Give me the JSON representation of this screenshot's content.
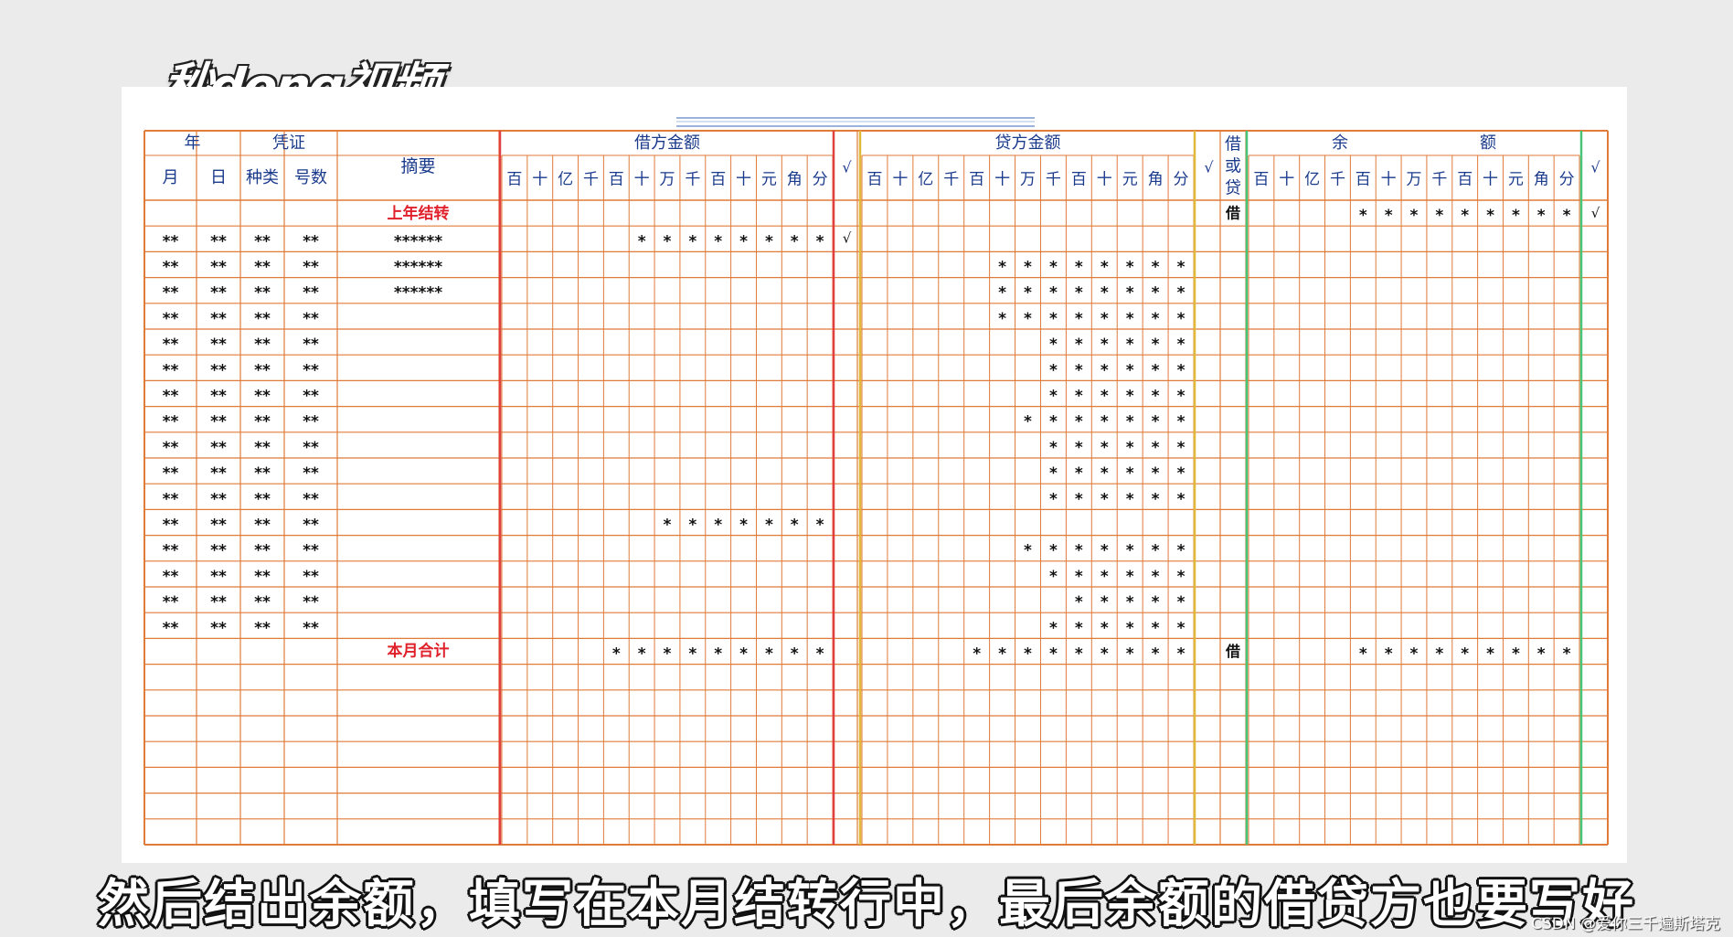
{
  "brand": {
    "logo_text": "秒dong视频"
  },
  "ledger": {
    "colors": {
      "orange": "#e07b39",
      "red": "#e0403f",
      "yellow": "#e0b93a",
      "green": "#49c57a",
      "header_text": "#1a3a8c",
      "red_text": "#e0202a",
      "body_text": "#111111"
    },
    "header": {
      "year": "年",
      "voucher": "凭证",
      "month": "月",
      "day": "日",
      "voucher_type": "种类",
      "voucher_no": "号数",
      "summary": "摘要",
      "debit_amount": "借方金额",
      "credit_amount": "贷方金额",
      "debit_or_credit": "借或贷",
      "balance_left": "余",
      "balance_right": "额",
      "check": "√",
      "digit_units": [
        "百",
        "十",
        "亿",
        "千",
        "百",
        "十",
        "万",
        "千",
        "百",
        "十",
        "元",
        "角",
        "分"
      ]
    },
    "opening_row": {
      "summary": "上年结转",
      "direction": "借",
      "balance_digits": [
        "",
        "",
        "",
        "",
        "*",
        "*",
        "*",
        "*",
        "*",
        "*",
        "*",
        "*",
        "*"
      ],
      "balance_check": "√"
    },
    "rows": [
      {
        "date": [
          "**",
          "**",
          "**",
          "**"
        ],
        "summary": "******",
        "debit": [
          "",
          "",
          "",
          "",
          "",
          "*",
          "*",
          "*",
          "*",
          "*",
          "*",
          "*",
          "*"
        ],
        "debit_check": "√",
        "credit": [
          "",
          "",
          "",
          "",
          "",
          "",
          "",
          "",
          "",
          "",
          "",
          "",
          ""
        ]
      },
      {
        "date": [
          "**",
          "**",
          "**",
          "**"
        ],
        "summary": "******",
        "debit": [
          "",
          "",
          "",
          "",
          "",
          "",
          "",
          "",
          "",
          "",
          "",
          "",
          ""
        ],
        "credit": [
          "",
          "",
          "",
          "",
          "",
          "*",
          "*",
          "*",
          "*",
          "*",
          "*",
          "*",
          "*"
        ]
      },
      {
        "date": [
          "**",
          "**",
          "**",
          "**"
        ],
        "summary": "******",
        "debit": [
          "",
          "",
          "",
          "",
          "",
          "",
          "",
          "",
          "",
          "",
          "",
          "",
          ""
        ],
        "credit": [
          "",
          "",
          "",
          "",
          "",
          "*",
          "*",
          "*",
          "*",
          "*",
          "*",
          "*",
          "*"
        ]
      },
      {
        "date": [
          "**",
          "**",
          "**",
          "**"
        ],
        "summary": "",
        "debit": [
          "",
          "",
          "",
          "",
          "",
          "",
          "",
          "",
          "",
          "",
          "",
          "",
          ""
        ],
        "credit": [
          "",
          "",
          "",
          "",
          "",
          "*",
          "*",
          "*",
          "*",
          "*",
          "*",
          "*",
          "*"
        ]
      },
      {
        "date": [
          "**",
          "**",
          "**",
          "**"
        ],
        "summary": "",
        "debit": [
          "",
          "",
          "",
          "",
          "",
          "",
          "",
          "",
          "",
          "",
          "",
          "",
          ""
        ],
        "credit": [
          "",
          "",
          "",
          "",
          "",
          "",
          "",
          "*",
          "*",
          "*",
          "*",
          "*",
          "*"
        ]
      },
      {
        "date": [
          "**",
          "**",
          "**",
          "**"
        ],
        "summary": "",
        "debit": [
          "",
          "",
          "",
          "",
          "",
          "",
          "",
          "",
          "",
          "",
          "",
          "",
          ""
        ],
        "credit": [
          "",
          "",
          "",
          "",
          "",
          "",
          "",
          "*",
          "*",
          "*",
          "*",
          "*",
          "*"
        ]
      },
      {
        "date": [
          "**",
          "**",
          "**",
          "**"
        ],
        "summary": "",
        "debit": [
          "",
          "",
          "",
          "",
          "",
          "",
          "",
          "",
          "",
          "",
          "",
          "",
          ""
        ],
        "credit": [
          "",
          "",
          "",
          "",
          "",
          "",
          "",
          "*",
          "*",
          "*",
          "*",
          "*",
          "*"
        ]
      },
      {
        "date": [
          "**",
          "**",
          "**",
          "**"
        ],
        "summary": "",
        "debit": [
          "",
          "",
          "",
          "",
          "",
          "",
          "",
          "",
          "",
          "",
          "",
          "",
          ""
        ],
        "credit": [
          "",
          "",
          "",
          "",
          "",
          "",
          "*",
          "*",
          "*",
          "*",
          "*",
          "*",
          "*"
        ]
      },
      {
        "date": [
          "**",
          "**",
          "**",
          "**"
        ],
        "summary": "",
        "debit": [
          "",
          "",
          "",
          "",
          "",
          "",
          "",
          "",
          "",
          "",
          "",
          "",
          ""
        ],
        "credit": [
          "",
          "",
          "",
          "",
          "",
          "",
          "",
          "*",
          "*",
          "*",
          "*",
          "*",
          "*"
        ]
      },
      {
        "date": [
          "**",
          "**",
          "**",
          "**"
        ],
        "summary": "",
        "debit": [
          "",
          "",
          "",
          "",
          "",
          "",
          "",
          "",
          "",
          "",
          "",
          "",
          ""
        ],
        "credit": [
          "",
          "",
          "",
          "",
          "",
          "",
          "",
          "*",
          "*",
          "*",
          "*",
          "*",
          "*"
        ]
      },
      {
        "date": [
          "**",
          "**",
          "**",
          "**"
        ],
        "summary": "",
        "debit": [
          "",
          "",
          "",
          "",
          "",
          "",
          "",
          "",
          "",
          "",
          "",
          "",
          ""
        ],
        "credit": [
          "",
          "",
          "",
          "",
          "",
          "",
          "",
          "*",
          "*",
          "*",
          "*",
          "*",
          "*"
        ]
      },
      {
        "date": [
          "**",
          "**",
          "**",
          "**"
        ],
        "summary": "",
        "debit": [
          "",
          "",
          "",
          "",
          "",
          "",
          "*",
          "*",
          "*",
          "*",
          "*",
          "*",
          "*"
        ],
        "credit": [
          "",
          "",
          "",
          "",
          "",
          "",
          "",
          "",
          "",
          "",
          "",
          "",
          ""
        ]
      },
      {
        "date": [
          "**",
          "**",
          "**",
          "**"
        ],
        "summary": "",
        "debit": [
          "",
          "",
          "",
          "",
          "",
          "",
          "",
          "",
          "",
          "",
          "",
          "",
          ""
        ],
        "credit": [
          "",
          "",
          "",
          "",
          "",
          "",
          "*",
          "*",
          "*",
          "*",
          "*",
          "*",
          "*"
        ]
      },
      {
        "date": [
          "**",
          "**",
          "**",
          "**"
        ],
        "summary": "",
        "debit": [
          "",
          "",
          "",
          "",
          "",
          "",
          "",
          "",
          "",
          "",
          "",
          "",
          ""
        ],
        "credit": [
          "",
          "",
          "",
          "",
          "",
          "",
          "",
          "*",
          "*",
          "*",
          "*",
          "*",
          "*"
        ]
      },
      {
        "date": [
          "**",
          "**",
          "**",
          "**"
        ],
        "summary": "",
        "debit": [
          "",
          "",
          "",
          "",
          "",
          "",
          "",
          "",
          "",
          "",
          "",
          "",
          ""
        ],
        "credit": [
          "",
          "",
          "",
          "",
          "",
          "",
          "",
          "",
          "*",
          "*",
          "*",
          "*",
          "*"
        ]
      },
      {
        "date": [
          "**",
          "**",
          "**",
          "**"
        ],
        "summary": "",
        "debit": [
          "",
          "",
          "",
          "",
          "",
          "",
          "",
          "",
          "",
          "",
          "",
          "",
          ""
        ],
        "credit": [
          "",
          "",
          "",
          "",
          "",
          "",
          "",
          "*",
          "*",
          "*",
          "*",
          "*",
          "*"
        ]
      }
    ],
    "total_row": {
      "summary": "本月合计",
      "debit": [
        "",
        "",
        "",
        "",
        "*",
        "*",
        "*",
        "*",
        "*",
        "*",
        "*",
        "*",
        "*"
      ],
      "credit": [
        "",
        "",
        "",
        "",
        "*",
        "*",
        "*",
        "*",
        "*",
        "*",
        "*",
        "*",
        "*"
      ],
      "direction": "借",
      "balance": [
        "",
        "",
        "",
        "",
        "*",
        "*",
        "*",
        "*",
        "*",
        "*",
        "*",
        "*",
        "*"
      ]
    },
    "empty_rows": 8
  },
  "subtitle": "然后结出余额，填写在本月结转行中，最后余额的借贷方也要写好",
  "watermark": "CSDN @爱你三千遍斯塔克"
}
